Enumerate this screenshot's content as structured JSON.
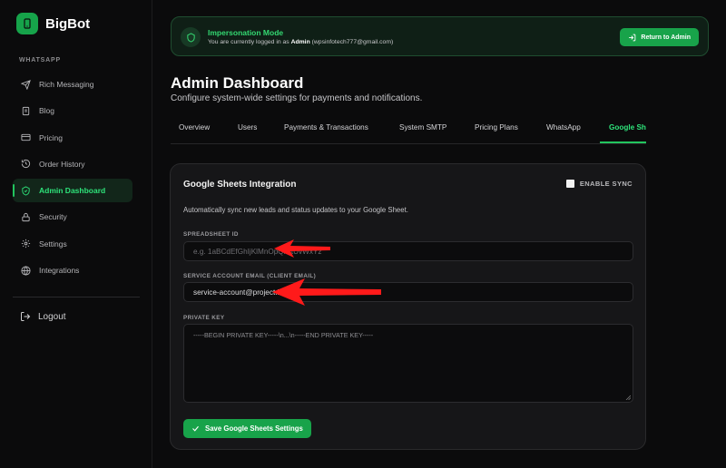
{
  "brand": {
    "name": "BigBot"
  },
  "sidebar": {
    "section_label": "WHATSAPP",
    "items": [
      {
        "label": "Rich Messaging",
        "icon": "send-icon"
      },
      {
        "label": "Blog",
        "icon": "document-icon"
      },
      {
        "label": "Pricing",
        "icon": "credit-card-icon"
      },
      {
        "label": "Order History",
        "icon": "history-icon"
      },
      {
        "label": "Admin Dashboard",
        "icon": "shield-icon",
        "active": true
      },
      {
        "label": "Security",
        "icon": "lock-icon"
      },
      {
        "label": "Settings",
        "icon": "gear-icon"
      },
      {
        "label": "Integrations",
        "icon": "globe-icon"
      }
    ],
    "logout_label": "Logout"
  },
  "banner": {
    "title": "Impersonation Mode",
    "text_prefix": "You are currently logged in as",
    "user_name": "Admin",
    "user_email": "(wpsinfotech777@gmail.com)",
    "return_label": "Return to Admin"
  },
  "header": {
    "title": "Admin Dashboard",
    "subtitle": "Configure system-wide settings for payments and notifications."
  },
  "tabs": [
    "Overview",
    "Users",
    "Payments & Transactions",
    "System SMTP",
    "Pricing Plans",
    "WhatsApp",
    "Google Sheets"
  ],
  "active_tab": "Google Sheets",
  "card": {
    "title": "Google Sheets Integration",
    "sync_label": "ENABLE SYNC",
    "sync_checked": false,
    "description": "Automatically sync new leads and status updates to your Google Sheet.",
    "spreadsheet_label": "SPREADSHEET ID",
    "spreadsheet_placeholder": "e.g. 1aBCdEfGhIjKlMnOpQrStUvWxYz",
    "service_label": "SERVICE ACCOUNT EMAIL (CLIENT EMAIL)",
    "service_value": "service-account@project.iam.gserviceaccount.com",
    "private_key_label": "PRIVATE KEY",
    "private_key_placeholder": "-----BEGIN PRIVATE KEY-----\\n...\\n-----END PRIVATE KEY-----",
    "save_label": "Save Google Sheets Settings"
  },
  "colors": {
    "accent": "#22c55e",
    "arrow": "#ff1a1a",
    "background": "#0b0b0c",
    "card": "#161618"
  }
}
